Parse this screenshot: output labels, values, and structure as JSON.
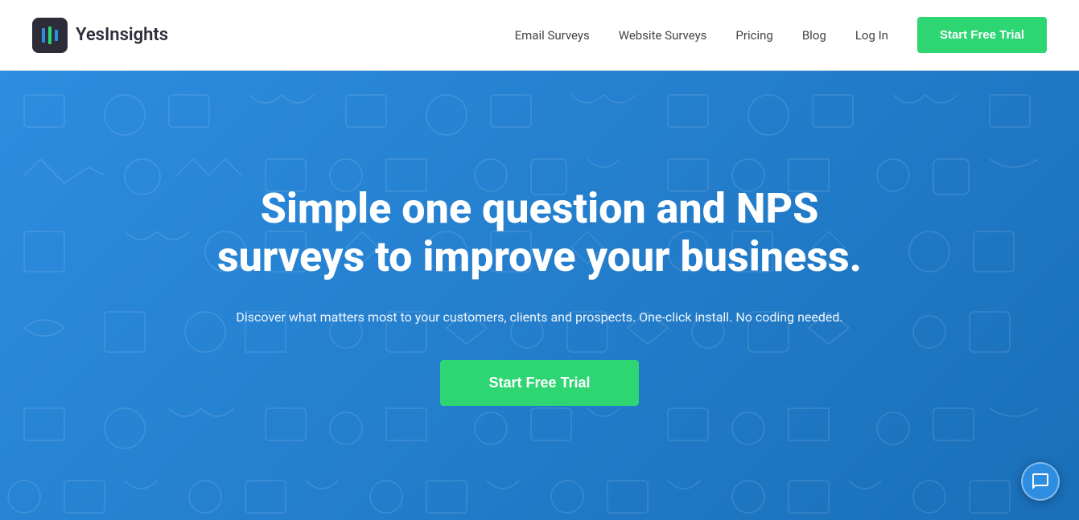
{
  "brand": {
    "name": "YesInsights"
  },
  "navbar": {
    "links": [
      {
        "id": "email-surveys",
        "label": "Email Surveys"
      },
      {
        "id": "website-surveys",
        "label": "Website Surveys"
      },
      {
        "id": "pricing",
        "label": "Pricing"
      },
      {
        "id": "blog",
        "label": "Blog"
      },
      {
        "id": "login",
        "label": "Log In"
      }
    ],
    "cta_label": "Start Free Trial"
  },
  "hero": {
    "title": "Simple one question and NPS surveys to improve your business.",
    "subtitle": "Discover what matters most to your customers, clients and prospects. One-click install. No coding needed.",
    "cta_label": "Start Free Trial"
  },
  "colors": {
    "green": "#2ed573",
    "blue": "#2d8de0",
    "dark": "#2d2d3a"
  }
}
